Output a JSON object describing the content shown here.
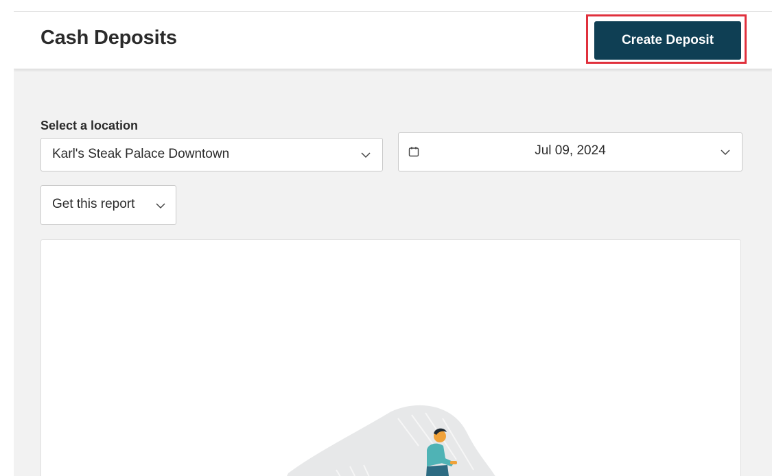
{
  "header": {
    "title": "Cash Deposits",
    "create_button_label": "Create Deposit"
  },
  "filters": {
    "location_label": "Select a location",
    "location_value": "Karl's Steak Palace Downtown",
    "date_value": "Jul 09, 2024",
    "report_label": "Get this report"
  },
  "colors": {
    "primary_button": "#0f3f54",
    "highlight_border": "#e0303c",
    "page_background": "#f2f2f2",
    "illustration_teal": "#4fb3b5"
  },
  "icons": {
    "calendar": "calendar-icon",
    "chevron": "chevron-down-icon"
  }
}
